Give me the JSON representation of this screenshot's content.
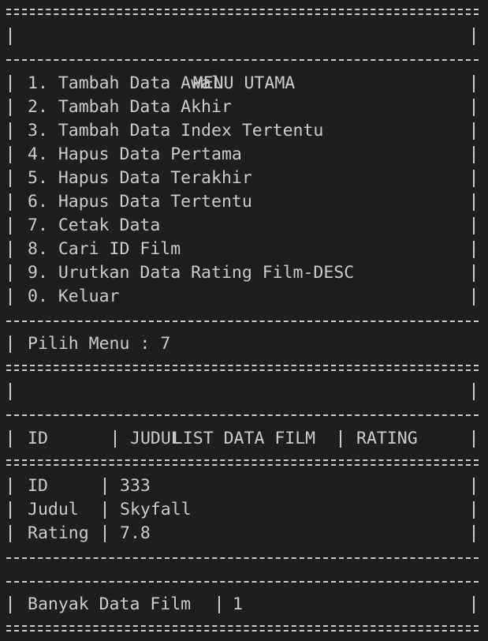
{
  "menu": {
    "title": "MENU UTAMA",
    "items": [
      "1. Tambah Data Awal",
      "2. Tambah Data Akhir",
      "3. Tambah Data Index Tertentu",
      "4. Hapus Data Pertama",
      "5. Hapus Data Terakhir",
      "6. Hapus Data Tertentu",
      "7. Cetak Data",
      "8. Cari ID Film",
      "9. Urutkan Data Rating Film-DESC",
      "0. Keluar"
    ],
    "prompt": "Pilih Menu : 7"
  },
  "list": {
    "title": "LIST DATA FILM",
    "headers": [
      "ID",
      "JUDUL",
      "RATING"
    ],
    "record": [
      {
        "label": "ID",
        "value": "333"
      },
      {
        "label": "Judul",
        "value": "Skyfall"
      },
      {
        "label": "Rating",
        "value": "7.8"
      }
    ],
    "count_label": "Banyak Data Film",
    "count_value": "1"
  },
  "colors": {
    "background": "#1e1e1e",
    "text": "#cccccc"
  }
}
